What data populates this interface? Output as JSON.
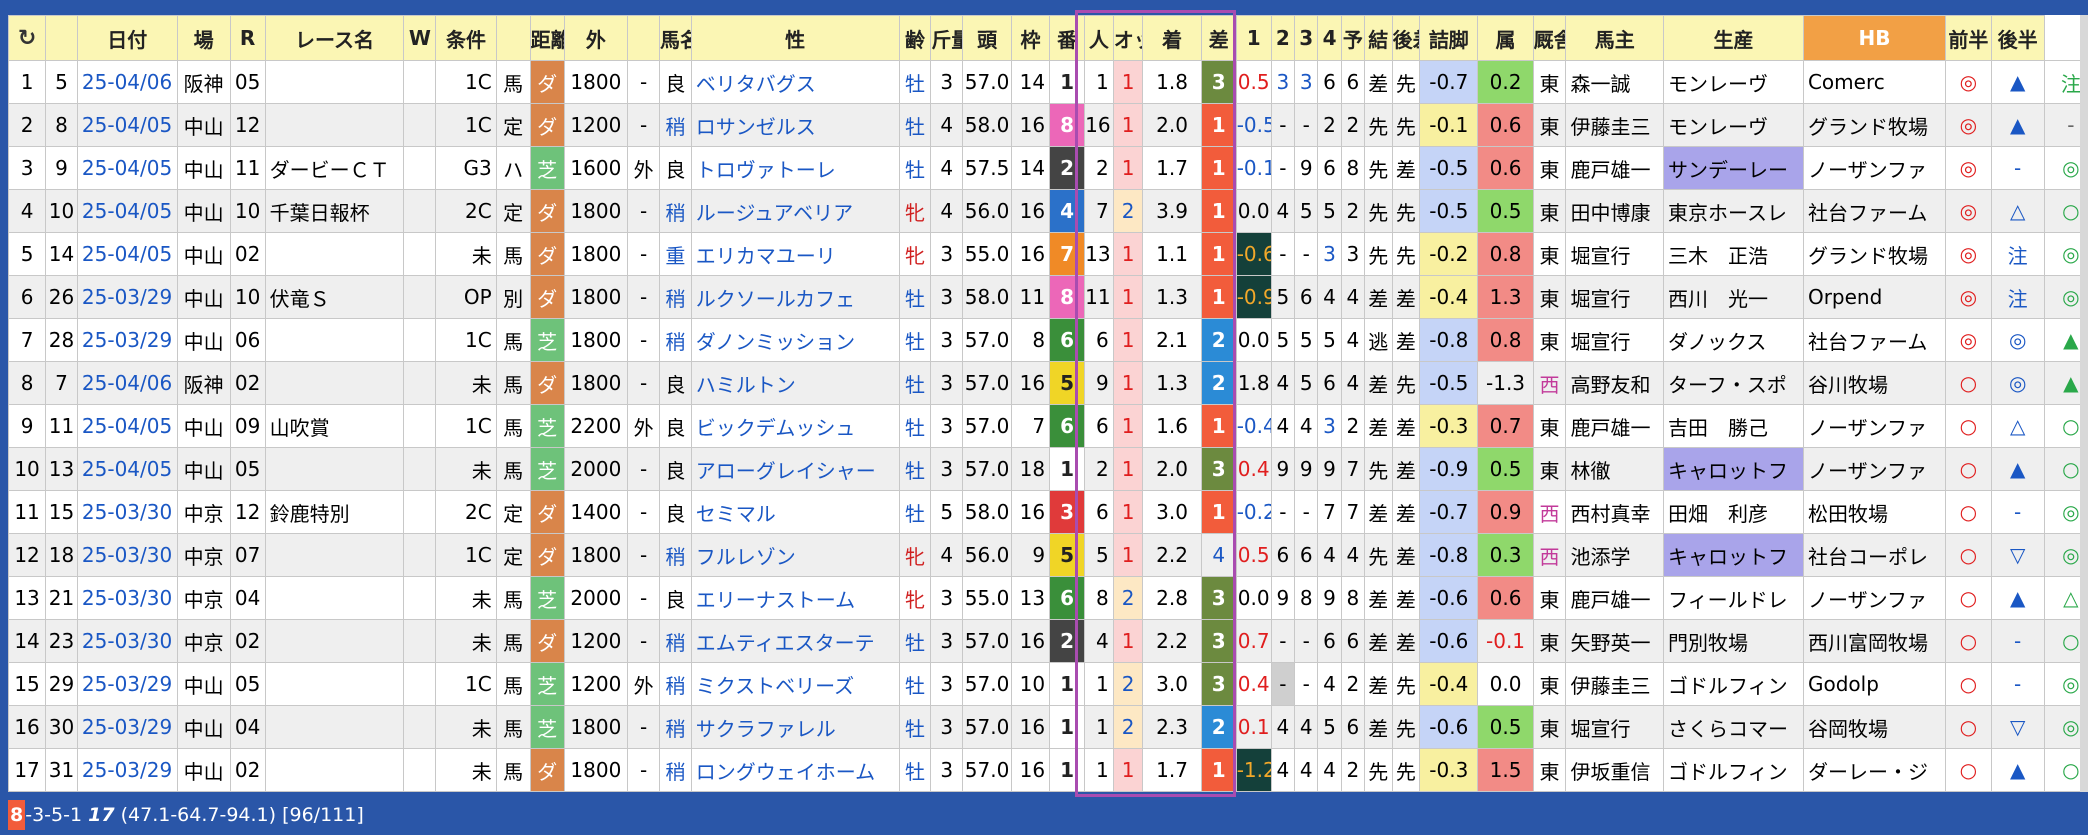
{
  "headers": [
    "",
    "",
    "日付",
    "場",
    "R",
    "レース名",
    "W",
    "条件",
    "",
    "距離",
    "外",
    "",
    "馬名",
    "性",
    "齢",
    "斤量",
    "頭",
    "枠",
    "番",
    "人",
    "オッズ",
    "着",
    "差",
    "1",
    "2",
    "3",
    "4",
    "予",
    "結",
    "後差",
    "詰脚",
    "属",
    "厩舎",
    "馬主",
    "生産",
    "HB",
    "前半",
    "後半"
  ],
  "refresh_icon": "refresh-icon",
  "rows": [
    {
      "no": "1",
      "id": "5",
      "date": "25-04/06",
      "place": "阪神",
      "r": "05",
      "name": "",
      "w": "",
      "cond": "1C",
      "kind": "馬",
      "surf": "ダ",
      "dist": "1800",
      "out": "-",
      "baba": "良",
      "horse": "ベリタバグス",
      "sex": "牡",
      "age": "3",
      "kin": "57.0",
      "heads": "14",
      "waku": "1",
      "ban": "1",
      "nin": "1",
      "odds": "1.8",
      "chaku": "3",
      "sa": "0.5",
      "c1": "3",
      "c2": "3",
      "c3": "6",
      "c4": "6",
      "yo": "差",
      "ketsu": "先",
      "kosa": "-0.7",
      "tsume": "0.2",
      "zoku": "東",
      "kyu": "森一誠",
      "owner": "モンレーヴ",
      "seisan": "Comerc",
      "hb": "◎",
      "zen": "▲",
      "kou": "注"
    },
    {
      "no": "2",
      "id": "8",
      "date": "25-04/05",
      "place": "中山",
      "r": "12",
      "name": "",
      "w": "",
      "cond": "1C",
      "kind": "定",
      "surf": "ダ",
      "dist": "1200",
      "out": "-",
      "baba": "稍",
      "horse": "ロサンゼルス",
      "sex": "牡",
      "age": "4",
      "kin": "58.0",
      "heads": "16",
      "waku": "8",
      "ban": "16",
      "nin": "1",
      "odds": "2.0",
      "chaku": "1",
      "sa": "-0.5",
      "c1": "-",
      "c2": "-",
      "c3": "2",
      "c4": "2",
      "yo": "先",
      "ketsu": "先",
      "kosa": "-0.1",
      "tsume": "0.6",
      "zoku": "東",
      "kyu": "伊藤圭三",
      "owner": "モンレーヴ",
      "seisan": "グランド牧場",
      "hb": "◎",
      "zen": "▲",
      "kou": "-"
    },
    {
      "no": "3",
      "id": "9",
      "date": "25-04/05",
      "place": "中山",
      "r": "11",
      "name": "ダービーＣＴ",
      "w": "",
      "cond": "G3",
      "kind": "ハ",
      "surf": "芝",
      "dist": "1600",
      "out": "外",
      "baba": "良",
      "horse": "トロヴァトーレ",
      "sex": "牡",
      "age": "4",
      "kin": "57.5",
      "heads": "14",
      "waku": "2",
      "ban": "2",
      "nin": "1",
      "odds": "1.7",
      "chaku": "1",
      "sa": "-0.1",
      "c1": "-",
      "c2": "9",
      "c3": "6",
      "c4": "8",
      "yo": "先",
      "ketsu": "差",
      "kosa": "-0.5",
      "tsume": "0.6",
      "zoku": "東",
      "kyu": "鹿戸雄一",
      "owner": "サンデーレー",
      "seisan": "ノーザンファ",
      "hb": "◎",
      "zen": "-",
      "kou": "◎"
    },
    {
      "no": "4",
      "id": "10",
      "date": "25-04/05",
      "place": "中山",
      "r": "10",
      "name": "千葉日報杯",
      "w": "",
      "cond": "2C",
      "kind": "定",
      "surf": "ダ",
      "dist": "1800",
      "out": "-",
      "baba": "稍",
      "horse": "ルージュアベリア",
      "sex": "牝",
      "age": "4",
      "kin": "56.0",
      "heads": "16",
      "waku": "4",
      "ban": "7",
      "nin": "2",
      "odds": "3.9",
      "chaku": "1",
      "sa": "0.0",
      "c1": "4",
      "c2": "5",
      "c3": "5",
      "c4": "2",
      "yo": "先",
      "ketsu": "先",
      "kosa": "-0.5",
      "tsume": "0.5",
      "zoku": "東",
      "kyu": "田中博康",
      "owner": "東京ホースレ",
      "seisan": "社台ファーム",
      "hb": "◎",
      "zen": "△",
      "kou": "○"
    },
    {
      "no": "5",
      "id": "14",
      "date": "25-04/05",
      "place": "中山",
      "r": "02",
      "name": "",
      "w": "",
      "cond": "未",
      "kind": "馬",
      "surf": "ダ",
      "dist": "1800",
      "out": "-",
      "baba": "重",
      "horse": "エリカマユーリ",
      "sex": "牝",
      "age": "3",
      "kin": "55.0",
      "heads": "16",
      "waku": "7",
      "ban": "13",
      "nin": "1",
      "odds": "1.1",
      "chaku": "1",
      "sa": "-0.6",
      "c1": "-",
      "c2": "-",
      "c3": "3",
      "c4": "3",
      "yo": "先",
      "ketsu": "先",
      "kosa": "-0.2",
      "tsume": "0.8",
      "zoku": "東",
      "kyu": "堀宣行",
      "owner": "三木　正浩",
      "seisan": "グランド牧場",
      "hb": "◎",
      "zen": "注",
      "kou": "◎"
    },
    {
      "no": "6",
      "id": "26",
      "date": "25-03/29",
      "place": "中山",
      "r": "10",
      "name": "伏竜Ｓ",
      "w": "",
      "cond": "OP",
      "kind": "別",
      "surf": "ダ",
      "dist": "1800",
      "out": "-",
      "baba": "稍",
      "horse": "ルクソールカフェ",
      "sex": "牡",
      "age": "3",
      "kin": "58.0",
      "heads": "11",
      "waku": "8",
      "ban": "11",
      "nin": "1",
      "odds": "1.3",
      "chaku": "1",
      "sa": "-0.9",
      "c1": "5",
      "c2": "6",
      "c3": "4",
      "c4": "4",
      "yo": "差",
      "ketsu": "差",
      "kosa": "-0.4",
      "tsume": "1.3",
      "zoku": "東",
      "kyu": "堀宣行",
      "owner": "西川　光一",
      "seisan": "Orpend",
      "hb": "◎",
      "zen": "注",
      "kou": "◎"
    },
    {
      "no": "7",
      "id": "28",
      "date": "25-03/29",
      "place": "中山",
      "r": "06",
      "name": "",
      "w": "",
      "cond": "1C",
      "kind": "馬",
      "surf": "芝",
      "dist": "1800",
      "out": "-",
      "baba": "稍",
      "horse": "ダノンミッション",
      "sex": "牡",
      "age": "3",
      "kin": "57.0",
      "heads": "8",
      "waku": "6",
      "ban": "6",
      "nin": "1",
      "odds": "2.1",
      "chaku": "2",
      "sa": "0.0",
      "c1": "5",
      "c2": "5",
      "c3": "5",
      "c4": "4",
      "yo": "逃",
      "ketsu": "差",
      "kosa": "-0.8",
      "tsume": "0.8",
      "zoku": "東",
      "kyu": "堀宣行",
      "owner": "ダノックス",
      "seisan": "社台ファーム",
      "hb": "◎",
      "zen": "◎",
      "kou": "▲"
    },
    {
      "no": "8",
      "id": "7",
      "date": "25-04/06",
      "place": "阪神",
      "r": "02",
      "name": "",
      "w": "",
      "cond": "未",
      "kind": "馬",
      "surf": "ダ",
      "dist": "1800",
      "out": "-",
      "baba": "良",
      "horse": "ハミルトン",
      "sex": "牡",
      "age": "3",
      "kin": "57.0",
      "heads": "16",
      "waku": "5",
      "ban": "9",
      "nin": "1",
      "odds": "1.3",
      "chaku": "2",
      "sa": "1.8",
      "c1": "4",
      "c2": "5",
      "c3": "6",
      "c4": "4",
      "yo": "差",
      "ketsu": "先",
      "kosa": "-0.5",
      "tsume": "-1.3",
      "zoku": "西",
      "kyu": "高野友和",
      "owner": "ターフ・スポ",
      "seisan": "谷川牧場",
      "hb": "○",
      "zen": "◎",
      "kou": "▲"
    },
    {
      "no": "9",
      "id": "11",
      "date": "25-04/05",
      "place": "中山",
      "r": "09",
      "name": "山吹賞",
      "w": "",
      "cond": "1C",
      "kind": "馬",
      "surf": "芝",
      "dist": "2200",
      "out": "外",
      "baba": "良",
      "horse": "ビックデムッシュ",
      "sex": "牡",
      "age": "3",
      "kin": "57.0",
      "heads": "7",
      "waku": "6",
      "ban": "6",
      "nin": "1",
      "odds": "1.6",
      "chaku": "1",
      "sa": "-0.4",
      "c1": "4",
      "c2": "4",
      "c3": "3",
      "c4": "2",
      "yo": "差",
      "ketsu": "差",
      "kosa": "-0.3",
      "tsume": "0.7",
      "zoku": "東",
      "kyu": "鹿戸雄一",
      "owner": "吉田　勝己",
      "seisan": "ノーザンファ",
      "hb": "○",
      "zen": "△",
      "kou": "○"
    },
    {
      "no": "10",
      "id": "13",
      "date": "25-04/05",
      "place": "中山",
      "r": "05",
      "name": "",
      "w": "",
      "cond": "未",
      "kind": "馬",
      "surf": "芝",
      "dist": "2000",
      "out": "-",
      "baba": "良",
      "horse": "アローグレイシャー",
      "sex": "牡",
      "age": "3",
      "kin": "57.0",
      "heads": "18",
      "waku": "1",
      "ban": "2",
      "nin": "1",
      "odds": "2.0",
      "chaku": "3",
      "sa": "0.4",
      "c1": "9",
      "c2": "9",
      "c3": "9",
      "c4": "7",
      "yo": "先",
      "ketsu": "差",
      "kosa": "-0.9",
      "tsume": "0.5",
      "zoku": "東",
      "kyu": "林徹",
      "owner": "キャロットフ",
      "seisan": "ノーザンファ",
      "hb": "○",
      "zen": "▲",
      "kou": "○"
    },
    {
      "no": "11",
      "id": "15",
      "date": "25-03/30",
      "place": "中京",
      "r": "12",
      "name": "鈴鹿特別",
      "w": "",
      "cond": "2C",
      "kind": "定",
      "surf": "ダ",
      "dist": "1400",
      "out": "-",
      "baba": "良",
      "horse": "セミマル",
      "sex": "牡",
      "age": "5",
      "kin": "58.0",
      "heads": "16",
      "waku": "3",
      "ban": "6",
      "nin": "1",
      "odds": "3.0",
      "chaku": "1",
      "sa": "-0.2",
      "c1": "-",
      "c2": "-",
      "c3": "7",
      "c4": "7",
      "yo": "差",
      "ketsu": "差",
      "kosa": "-0.7",
      "tsume": "0.9",
      "zoku": "西",
      "kyu": "西村真幸",
      "owner": "田畑　利彦",
      "seisan": "松田牧場",
      "hb": "○",
      "zen": "-",
      "kou": "◎"
    },
    {
      "no": "12",
      "id": "18",
      "date": "25-03/30",
      "place": "中京",
      "r": "07",
      "name": "",
      "w": "",
      "cond": "1C",
      "kind": "定",
      "surf": "ダ",
      "dist": "1800",
      "out": "-",
      "baba": "稍",
      "horse": "フルレゾン",
      "sex": "牝",
      "age": "4",
      "kin": "56.0",
      "heads": "9",
      "waku": "5",
      "ban": "5",
      "nin": "1",
      "odds": "2.2",
      "chaku": "4",
      "sa": "0.5",
      "c1": "6",
      "c2": "6",
      "c3": "4",
      "c4": "4",
      "yo": "先",
      "ketsu": "差",
      "kosa": "-0.8",
      "tsume": "0.3",
      "zoku": "西",
      "kyu": "池添学",
      "owner": "キャロットフ",
      "seisan": "社台コーポレ",
      "hb": "○",
      "zen": "▽",
      "kou": "◎"
    },
    {
      "no": "13",
      "id": "21",
      "date": "25-03/30",
      "place": "中京",
      "r": "04",
      "name": "",
      "w": "",
      "cond": "未",
      "kind": "馬",
      "surf": "芝",
      "dist": "2000",
      "out": "-",
      "baba": "良",
      "horse": "エリーナストーム",
      "sex": "牝",
      "age": "3",
      "kin": "55.0",
      "heads": "13",
      "waku": "6",
      "ban": "8",
      "nin": "2",
      "odds": "2.8",
      "chaku": "3",
      "sa": "0.0",
      "c1": "9",
      "c2": "8",
      "c3": "9",
      "c4": "8",
      "yo": "差",
      "ketsu": "差",
      "kosa": "-0.6",
      "tsume": "0.6",
      "zoku": "東",
      "kyu": "鹿戸雄一",
      "owner": "フィールドレ",
      "seisan": "ノーザンファ",
      "hb": "○",
      "zen": "▲",
      "kou": "△"
    },
    {
      "no": "14",
      "id": "23",
      "date": "25-03/30",
      "place": "中京",
      "r": "02",
      "name": "",
      "w": "",
      "cond": "未",
      "kind": "馬",
      "surf": "ダ",
      "dist": "1200",
      "out": "-",
      "baba": "稍",
      "horse": "エムティエスターテ",
      "sex": "牡",
      "age": "3",
      "kin": "57.0",
      "heads": "16",
      "waku": "2",
      "ban": "4",
      "nin": "1",
      "odds": "2.2",
      "chaku": "3",
      "sa": "0.7",
      "c1": "-",
      "c2": "-",
      "c3": "6",
      "c4": "6",
      "yo": "差",
      "ketsu": "差",
      "kosa": "-0.6",
      "tsume": "-0.1",
      "zoku": "東",
      "kyu": "矢野英一",
      "owner": "門別牧場",
      "seisan": "西川富岡牧場",
      "hb": "○",
      "zen": "-",
      "kou": "○"
    },
    {
      "no": "15",
      "id": "29",
      "date": "25-03/29",
      "place": "中山",
      "r": "05",
      "name": "",
      "w": "",
      "cond": "1C",
      "kind": "馬",
      "surf": "芝",
      "dist": "1200",
      "out": "外",
      "baba": "稍",
      "horse": "ミクストベリーズ",
      "sex": "牡",
      "age": "3",
      "kin": "57.0",
      "heads": "10",
      "waku": "1",
      "ban": "1",
      "nin": "2",
      "odds": "3.0",
      "chaku": "3",
      "sa": "0.4",
      "c1": "-",
      "c2": "-",
      "c3": "4",
      "c4": "2",
      "yo": "差",
      "ketsu": "先",
      "kosa": "-0.4",
      "tsume": "0.0",
      "zoku": "東",
      "kyu": "伊藤圭三",
      "owner": "ゴドルフィン",
      "seisan": "Godolp",
      "hb": "○",
      "zen": "-",
      "kou": "◎"
    },
    {
      "no": "16",
      "id": "30",
      "date": "25-03/29",
      "place": "中山",
      "r": "04",
      "name": "",
      "w": "",
      "cond": "未",
      "kind": "馬",
      "surf": "芝",
      "dist": "1800",
      "out": "-",
      "baba": "稍",
      "horse": "サクラファレル",
      "sex": "牡",
      "age": "3",
      "kin": "57.0",
      "heads": "16",
      "waku": "1",
      "ban": "1",
      "nin": "2",
      "odds": "2.3",
      "chaku": "2",
      "sa": "0.1",
      "c1": "4",
      "c2": "4",
      "c3": "5",
      "c4": "6",
      "yo": "差",
      "ketsu": "先",
      "kosa": "-0.6",
      "tsume": "0.5",
      "zoku": "東",
      "kyu": "堀宣行",
      "owner": "さくらコマー",
      "seisan": "谷岡牧場",
      "hb": "○",
      "zen": "▽",
      "kou": "◎"
    },
    {
      "no": "17",
      "id": "31",
      "date": "25-03/29",
      "place": "中山",
      "r": "02",
      "name": "",
      "w": "",
      "cond": "未",
      "kind": "馬",
      "surf": "ダ",
      "dist": "1800",
      "out": "-",
      "baba": "稍",
      "horse": "ロングウェイホーム",
      "sex": "牡",
      "age": "3",
      "kin": "57.0",
      "heads": "16",
      "waku": "1",
      "ban": "1",
      "nin": "1",
      "odds": "1.7",
      "chaku": "1",
      "sa": "-1.2",
      "c1": "4",
      "c2": "4",
      "c3": "4",
      "c4": "2",
      "yo": "先",
      "ketsu": "先",
      "kosa": "-0.3",
      "tsume": "1.5",
      "zoku": "東",
      "kyu": "伊坂重信",
      "owner": "ゴドルフィン",
      "seisan": "ダーレー・ジ",
      "hb": "○",
      "zen": "▲",
      "kou": "○"
    }
  ],
  "footer": {
    "first": "8",
    "rest": "-3-5-1 ",
    "total": "17",
    "stats": " (47.1-64.7-94.1) [96/111]"
  },
  "colors": {
    "background": "#2a56a8",
    "header": "#fbf6b4",
    "highlight_frame": "#a94cb0"
  }
}
